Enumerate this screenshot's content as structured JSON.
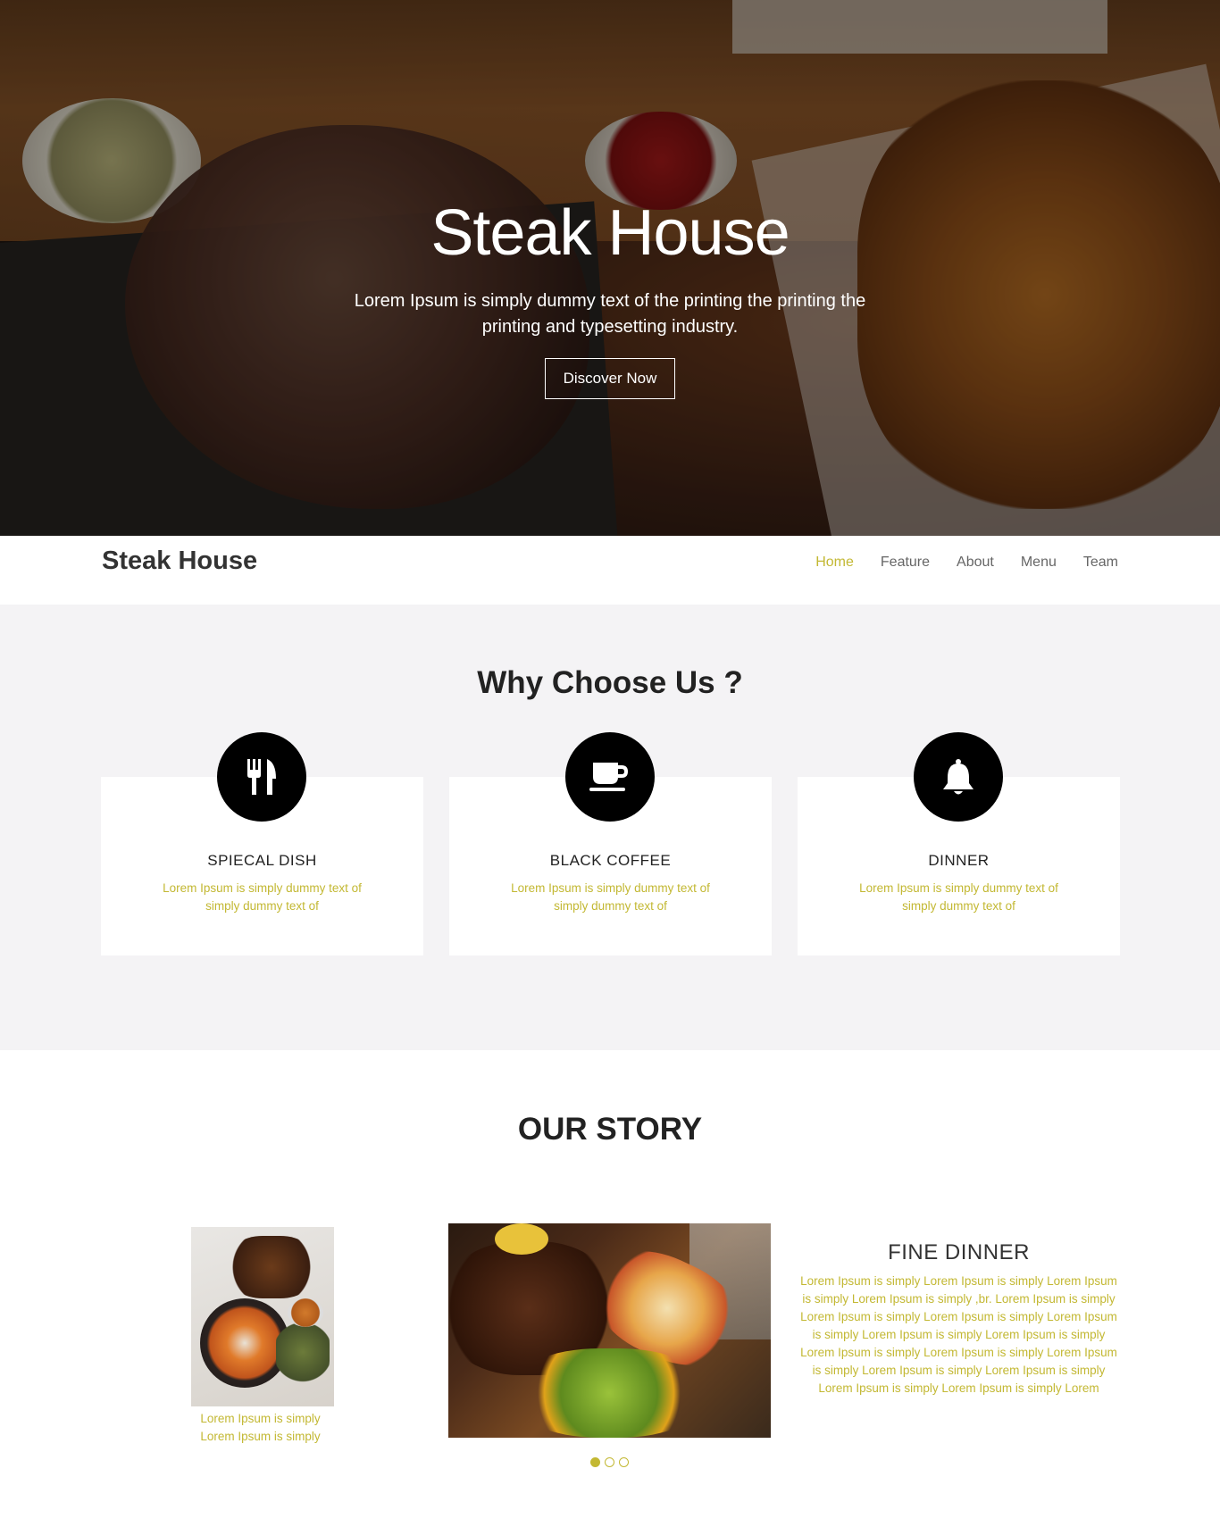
{
  "hero": {
    "title": "Steak House",
    "subtitle": "Lorem Ipsum is simply dummy text of the printing the printing the printing and typesetting industry.",
    "button_label": "Discover Now"
  },
  "nav": {
    "brand": "Steak House",
    "items": [
      {
        "label": "Home",
        "active": true
      },
      {
        "label": "Feature",
        "active": false
      },
      {
        "label": "About",
        "active": false
      },
      {
        "label": "Menu",
        "active": false
      },
      {
        "label": "Team",
        "active": false
      }
    ]
  },
  "why": {
    "title": "Why Choose Us ?",
    "cards": [
      {
        "icon": "cutlery-icon",
        "title": "SPIECAL DISH",
        "text": "Lorem Ipsum is simply dummy text of simply dummy text of"
      },
      {
        "icon": "coffee-cup-icon",
        "title": "BLACK COFFEE",
        "text": "Lorem Ipsum is simply dummy text of simply dummy text of"
      },
      {
        "icon": "bell-icon",
        "title": "DINNER",
        "text": "Lorem Ipsum is simply dummy text of simply dummy text of"
      }
    ]
  },
  "story": {
    "title": "OUR STORY",
    "caption": "Lorem Ipsum is simply Lorem Ipsum is simply",
    "fine_title": "FINE DINNER",
    "fine_text": "Lorem Ipsum is simply Lorem Ipsum is simply Lorem Ipsum is simply Lorem Ipsum is simply ,br. Lorem Ipsum is simply Lorem Ipsum is simply Lorem Ipsum is simply Lorem Ipsum is simply Lorem Ipsum is simply Lorem Ipsum is simply Lorem Ipsum is simply Lorem Ipsum is simply Lorem Ipsum is simply Lorem Ipsum is simply Lorem Ipsum is simply Lorem Ipsum is simply Lorem Ipsum is simply Lorem",
    "carousel_active_index": 0
  },
  "colors": {
    "accent": "#c3b833",
    "section_bg": "#f4f3f5",
    "heading": "#222222"
  }
}
